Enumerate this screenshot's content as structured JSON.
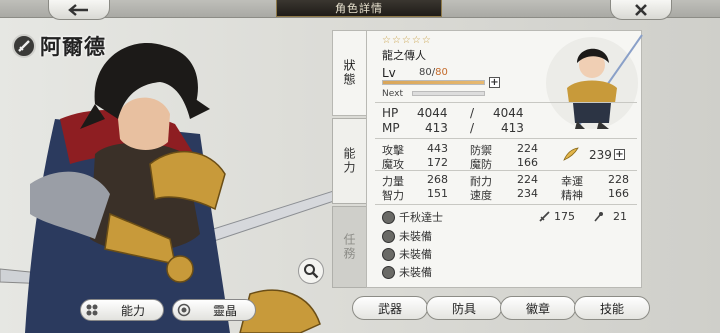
{
  "header": {
    "title": "角色詳情",
    "back_icon": "arrow-left-icon",
    "close_icon": "close-icon"
  },
  "character": {
    "name": "阿爾德"
  },
  "side_tabs": [
    {
      "label": "狀態",
      "active": true
    },
    {
      "label": "能力",
      "active": false
    },
    {
      "label": "任務",
      "active": false
    }
  ],
  "status": {
    "stars": "☆☆☆☆☆",
    "title": "龍之傳人",
    "lv_label": "Lv",
    "lv_current": "80",
    "lv_sep": "/",
    "lv_max": "80",
    "lv_progress": 1.0,
    "next_label": "Next",
    "hp_label": "HP",
    "hp_current": "4044",
    "hp_max": "4044",
    "mp_label": "MP",
    "mp_current": "413",
    "mp_max": "413",
    "slash": "/",
    "stats": [
      {
        "label": "攻擊",
        "value": "443"
      },
      {
        "label": "防禦",
        "value": "224"
      },
      {
        "label": "魔攻",
        "value": "172"
      },
      {
        "label": "魔防",
        "value": "166"
      },
      {
        "label": "力量",
        "value": "268"
      },
      {
        "label": "耐力",
        "value": "224"
      },
      {
        "label": "幸運",
        "value": "228"
      },
      {
        "label": "智力",
        "value": "151"
      },
      {
        "label": "速度",
        "value": "234"
      },
      {
        "label": "精神",
        "value": "166"
      }
    ],
    "feather_value": "239",
    "equipment": [
      {
        "name": "千秋達士",
        "icon": "sword-icon"
      },
      {
        "name": "未裝備",
        "icon": "armor-icon"
      },
      {
        "name": "未裝備",
        "icon": "badge-icon"
      },
      {
        "name": "未裝備",
        "icon": "skill-icon"
      }
    ],
    "weapon_attack": "175",
    "weapon_extra": "21"
  },
  "bottom_left": {
    "ability_label": "能力",
    "spirit_label": "靈晶"
  },
  "bottom_right": {
    "weapon": "武器",
    "armor": "防具",
    "badge": "徽章",
    "skill": "技能"
  },
  "colors": {
    "accent_gold": "#c8a14a",
    "title_bar": "#2a2620"
  }
}
